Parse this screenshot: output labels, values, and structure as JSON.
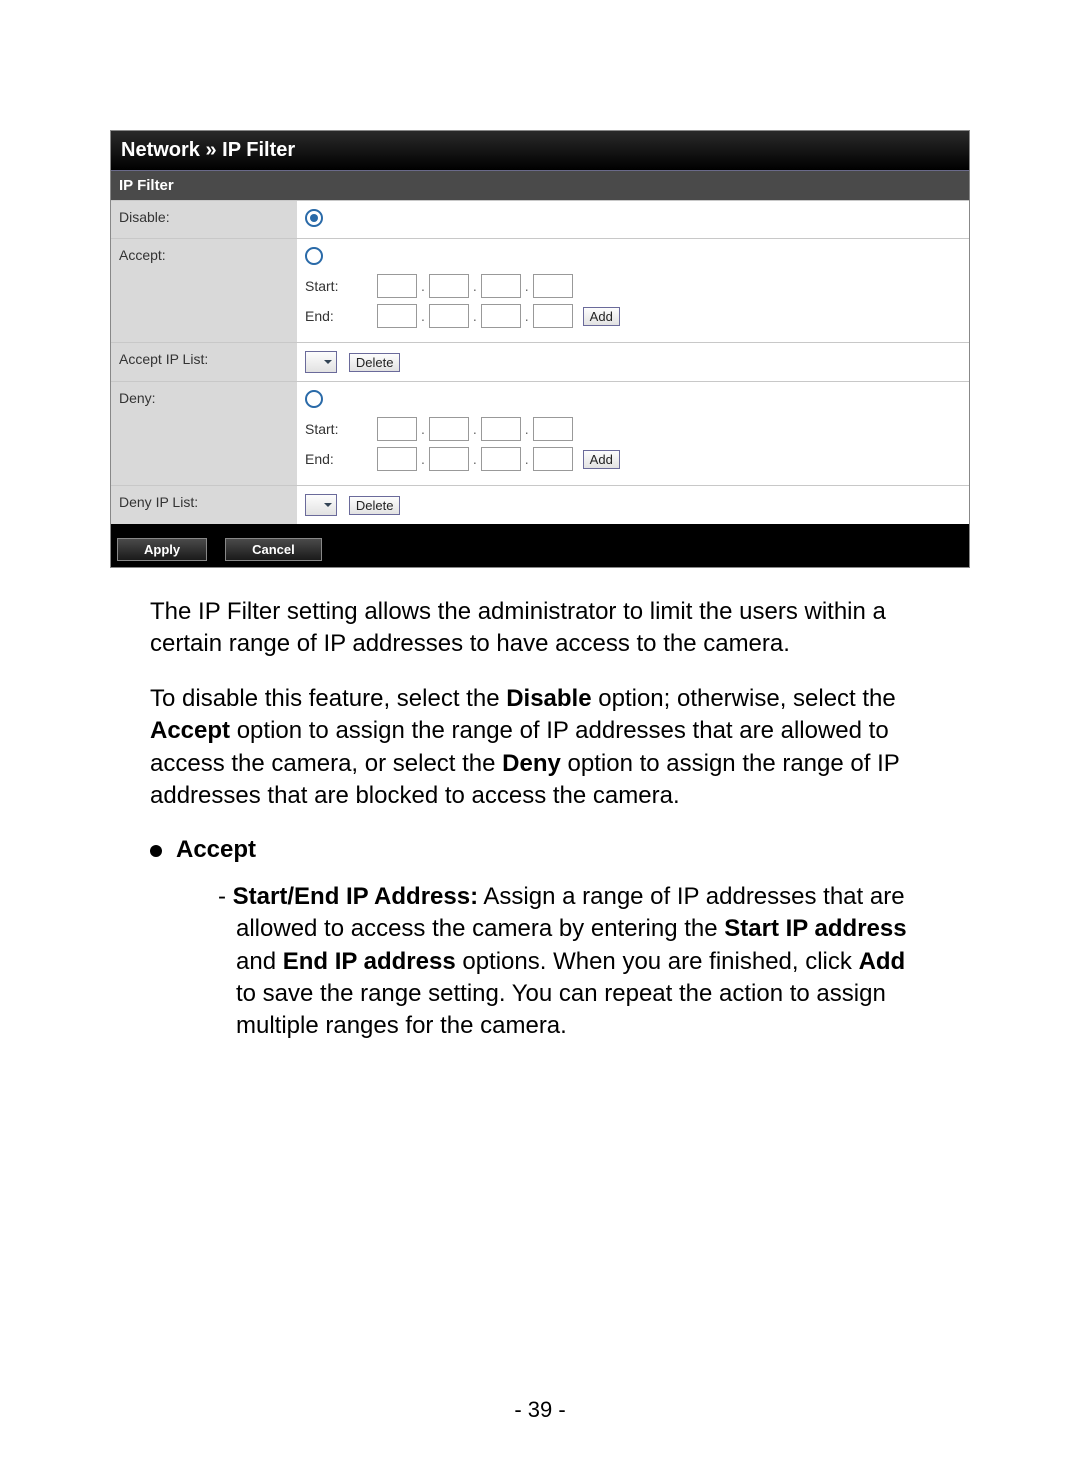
{
  "panel": {
    "header": "Network » IP Filter",
    "subheader": "IP Filter",
    "rows": {
      "disable_label": "Disable:",
      "accept_label": "Accept:",
      "accept_start": "Start:",
      "accept_end": "End:",
      "accept_add": "Add",
      "accept_list_label": "Accept IP List:",
      "accept_delete": "Delete",
      "deny_label": "Deny:",
      "deny_start": "Start:",
      "deny_end": "End:",
      "deny_add": "Add",
      "deny_list_label": "Deny IP List:",
      "deny_delete": "Delete"
    },
    "footer": {
      "apply": "Apply",
      "cancel": "Cancel"
    }
  },
  "doc": {
    "p1": "The IP Filter setting allows the administrator to limit the users within a certain range of IP addresses to have access to the camera.",
    "p2_a": "To disable this feature, select the ",
    "p2_b": "Disable",
    "p2_c": " option; otherwise, select the ",
    "p2_d": "Accept",
    "p2_e": " option to assign the range of IP addresses that are allowed to access the camera, or select the ",
    "p2_f": "Deny",
    "p2_g": " option to assign the range of IP addresses that are blocked to access the camera.",
    "bullet_accept": "Accept",
    "sub_dash": "- ",
    "sub_b1": "Start/End IP Address:",
    "sub_t1": " Assign a range of IP addresses that are allowed to access the camera by entering the ",
    "sub_b2": "Start IP address",
    "sub_t2": " and ",
    "sub_b3": "End IP address",
    "sub_t3": " options. When you are finished, click ",
    "sub_b4": "Add",
    "sub_t4": " to save the range setting. You can repeat the action to assign multiple ranges for the camera."
  },
  "page_number": "- 39 -"
}
